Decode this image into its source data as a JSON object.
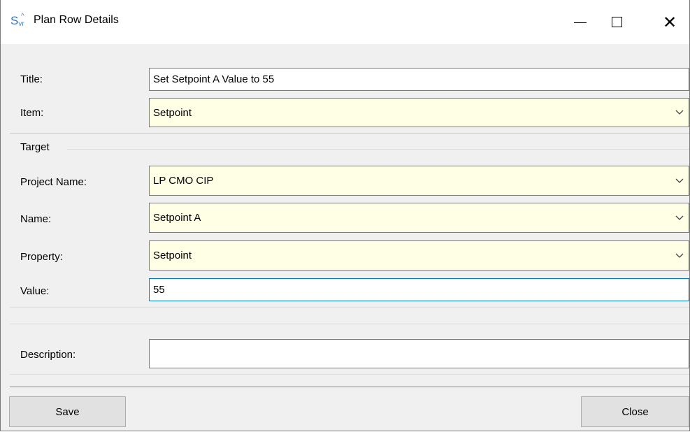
{
  "window": {
    "title": "Plan Row Details",
    "icon": "app-logo-icon"
  },
  "form": {
    "title_label": "Title:",
    "title_value": "Set Setpoint A Value to 55",
    "item_label": "Item:",
    "item_value": "Setpoint",
    "target_group_label": "Target",
    "project_name_label": "Project Name:",
    "project_name_value": "LP CMO CIP",
    "name_label": "Name:",
    "name_value": "Setpoint A",
    "property_label": "Property:",
    "property_value": "Setpoint",
    "value_label": "Value:",
    "value_value": "55",
    "description_label": "Description:",
    "description_value": ""
  },
  "buttons": {
    "save_label": "Save",
    "close_label": "Close"
  },
  "colors": {
    "combo_background": "#ffffe6",
    "focus_border": "#0078d7",
    "window_background": "#f0f0f0"
  }
}
